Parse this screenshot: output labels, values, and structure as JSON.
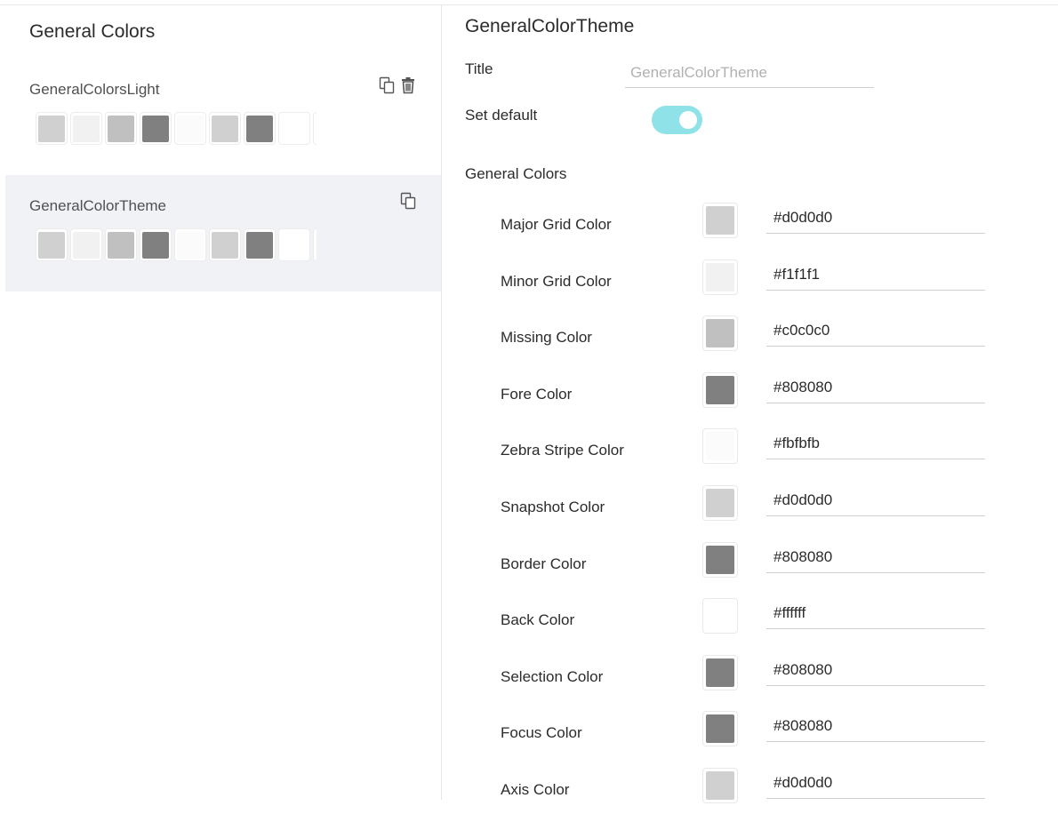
{
  "sidebar": {
    "title": "General Colors",
    "themes": [
      {
        "name": "GeneralColorsLight",
        "selected": false,
        "actions": [
          "copy-icon",
          "trash-icon"
        ],
        "swatches": [
          "#d0d0d0",
          "#f1f1f1",
          "#c0c0c0",
          "#808080",
          "#fbfbfb",
          "#d0d0d0",
          "#808080",
          "#ffffff"
        ]
      },
      {
        "name": "GeneralColorTheme",
        "selected": true,
        "actions": [
          "copy-icon"
        ],
        "swatches": [
          "#d0d0d0",
          "#f1f1f1",
          "#c0c0c0",
          "#808080",
          "#fbfbfb",
          "#d0d0d0",
          "#808080",
          "#ffffff"
        ]
      }
    ]
  },
  "editor": {
    "heading": "GeneralColorTheme",
    "title_label": "Title",
    "title_placeholder": "GeneralColorTheme",
    "default_label": "Set default",
    "default_on": true,
    "section_label": "General Colors",
    "colors": [
      {
        "label": "Major Grid Color",
        "hex": "#d0d0d0"
      },
      {
        "label": "Minor Grid Color",
        "hex": "#f1f1f1"
      },
      {
        "label": "Missing Color",
        "hex": "#c0c0c0"
      },
      {
        "label": "Fore Color",
        "hex": "#808080"
      },
      {
        "label": "Zebra Stripe Color",
        "hex": "#fbfbfb"
      },
      {
        "label": "Snapshot Color",
        "hex": "#d0d0d0"
      },
      {
        "label": "Border Color",
        "hex": "#808080"
      },
      {
        "label": "Back Color",
        "hex": "#ffffff"
      },
      {
        "label": "Selection Color",
        "hex": "#808080"
      },
      {
        "label": "Focus Color",
        "hex": "#808080"
      },
      {
        "label": "Axis Color",
        "hex": "#d0d0d0"
      }
    ]
  },
  "colors": {
    "toggle_on": "#8fe3e8",
    "selected_bg": "#f1f2f6"
  }
}
